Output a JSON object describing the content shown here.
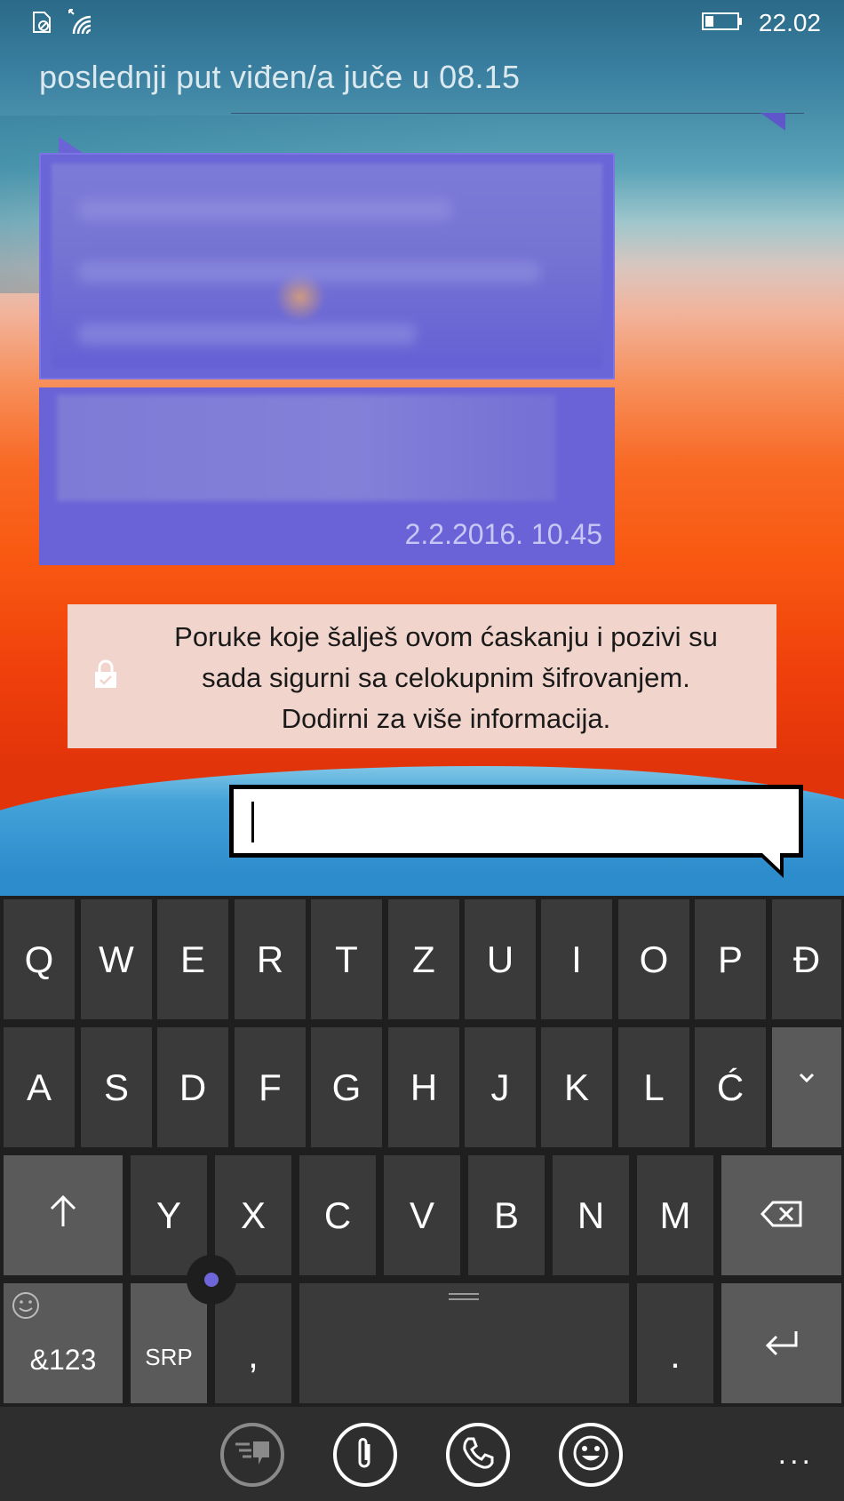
{
  "status_bar": {
    "time": "22.02",
    "icons": [
      "no-sim-icon",
      "wifi-icon",
      "battery-icon"
    ]
  },
  "chat": {
    "last_seen": "poslednji put viđen/a juče u 08.15",
    "messages": [
      {
        "content": "",
        "blurred": true
      },
      {
        "content": "",
        "blurred": true,
        "timestamp": "2.2.2016. 10.45"
      }
    ],
    "encryption_notice": {
      "line1": "Poruke koje šalješ ovom ćaskanju i pozivi su",
      "line2": "sada sigurni sa celokupnim šifrovanjem.",
      "line3": "Dodirni za više informacija.",
      "icon": "lock-icon"
    },
    "input": {
      "value": "",
      "placeholder": ""
    }
  },
  "keyboard": {
    "row1": [
      "Q",
      "W",
      "E",
      "R",
      "T",
      "Z",
      "U",
      "I",
      "O",
      "P",
      "Đ"
    ],
    "row2": [
      "A",
      "S",
      "D",
      "F",
      "G",
      "H",
      "J",
      "K",
      "L",
      "Ć"
    ],
    "row2_fn": "˅",
    "row3": [
      "Y",
      "X",
      "C",
      "V",
      "B",
      "N",
      "M"
    ],
    "row4": {
      "numbers": "&123",
      "language": "SRP",
      "comma": ",",
      "period": "."
    },
    "icons": [
      "shift-icon",
      "backspace-icon",
      "enter-icon",
      "emoji-face-icon",
      "collapse-icon"
    ]
  },
  "app_bar": {
    "buttons": [
      "quick-reply-icon",
      "attach-icon",
      "call-icon",
      "emoji-icon"
    ],
    "more": "..."
  },
  "colors": {
    "bubble": "#6a64d6",
    "notice_bg": "#f1d5cc",
    "keyboard_bg": "#1f1f1f",
    "key": "#3a3a3a",
    "key_fn": "#5a5a5a",
    "accent": "#6e66d8"
  }
}
